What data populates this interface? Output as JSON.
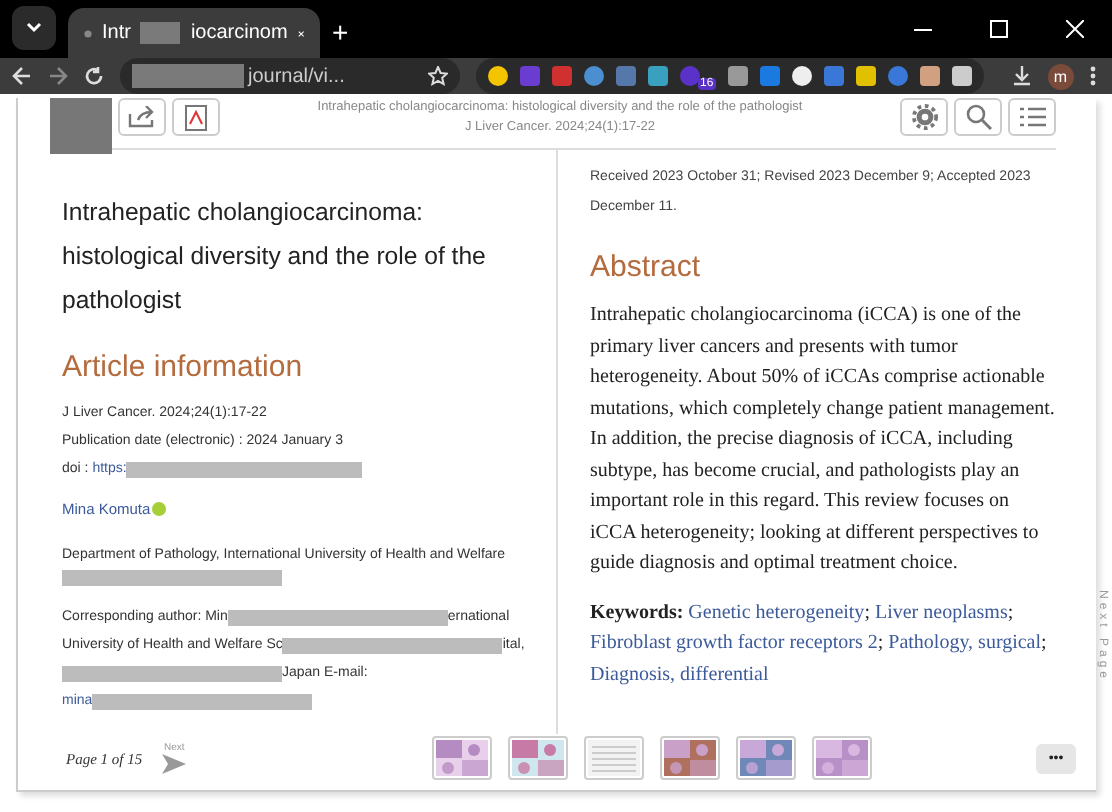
{
  "browser": {
    "tab": {
      "title_start": "Intr",
      "title_end": "iocarcinom",
      "selected": true
    },
    "new_tab": "+",
    "address": "journal/vi...",
    "extension_badge": "16",
    "profile": "m"
  },
  "viewer": {
    "header_title": "Intrahepatic cholangiocarcinoma: histological diversity and the role of the pathologist",
    "header_citation": "J Liver Cancer. 2024;24(1):17-22"
  },
  "left": {
    "title": "Intrahepatic cholangiocarcinoma: histological diversity and the role of the pathologist",
    "section": "Article information",
    "citation": "J Liver Cancer. 2024;24(1):17-22",
    "pub_date": "Publication date (electronic) : 2024 January 3",
    "doi_label": "doi :",
    "doi_link": "https:",
    "author": "Mina Komuta",
    "affiliation": [
      [
        {
          "kind": "text",
          "text": "Department of Pathology, International University of Health and Welfare"
        }
      ],
      [
        {
          "kind": "redacted"
        }
      ]
    ],
    "corresponding": [
      [
        {
          "kind": "text",
          "text": "Corresponding author: Min"
        },
        {
          "kind": "redacted"
        },
        {
          "kind": "text",
          "text": "ernational"
        }
      ],
      [
        {
          "kind": "text",
          "text": "University of Health and Welfare Sc"
        },
        {
          "kind": "redacted"
        },
        {
          "kind": "text",
          "text": "ital,"
        }
      ],
      [
        {
          "kind": "redacted"
        },
        {
          "kind": "text",
          "text": "Japan E-mail:"
        }
      ],
      [
        {
          "kind": "link",
          "text": "mina"
        },
        {
          "kind": "redacted"
        }
      ]
    ]
  },
  "right": {
    "dates": "Received 2023 October 31; Revised 2023 December 9; Accepted 2023 December 11.",
    "section": "Abstract",
    "abstract": "Intrahepatic cholangiocarcinoma (iCCA) is one of the primary liver cancers and presents with tumor heterogeneity. About 50% of iCCAs comprise actionable mutations, which completely change patient management. In addition, the precise diagnosis of iCCA, including subtype, has become crucial, and pathologists play an important role in this regard. This review focuses on iCCA heterogeneity; looking at different perspectives to guide diagnosis and optimal treatment choice.",
    "keywords_label": "Keywords:",
    "keyword_separator": ";",
    "keywords": [
      "Genetic heterogeneity",
      "Liver neoplasms",
      "Fibroblast growth factor receptors 2",
      "Pathology, surgical",
      "Diagnosis, differential"
    ]
  },
  "footer": {
    "page": "Page 1 of 15",
    "next": "Next",
    "side_next": "Next Page",
    "more": "•••",
    "thumbnails": [
      {
        "kind": "picture"
      },
      {
        "kind": "picture"
      },
      {
        "kind": "table"
      },
      {
        "kind": "picture"
      },
      {
        "kind": "picture"
      },
      {
        "kind": "picture"
      }
    ]
  }
}
